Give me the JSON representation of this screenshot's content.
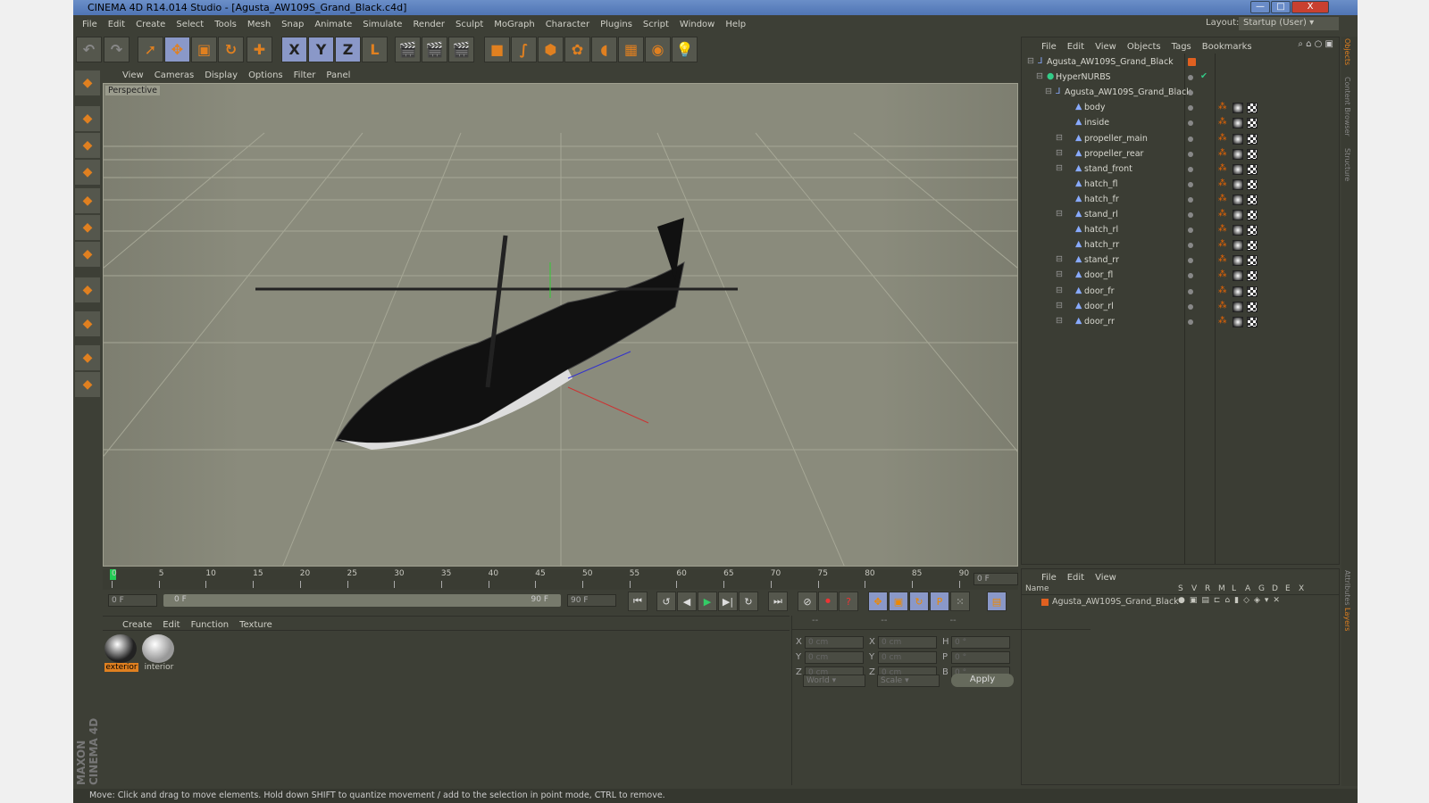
{
  "window": {
    "title": "CINEMA 4D R14.014 Studio - [Agusta_AW109S_Grand_Black.c4d]",
    "minimize": "—",
    "maximize": "□",
    "close": "X"
  },
  "menu": [
    "File",
    "Edit",
    "Create",
    "Select",
    "Tools",
    "Mesh",
    "Snap",
    "Animate",
    "Simulate",
    "Render",
    "Sculpt",
    "MoGraph",
    "Character",
    "Plugins",
    "Script",
    "Window",
    "Help"
  ],
  "layout": {
    "label": "Layout:",
    "value": "Startup (User)"
  },
  "toolbar": [
    {
      "icon": "undo-icon",
      "g": "↶"
    },
    {
      "icon": "redo-icon",
      "g": "↷"
    },
    {
      "icon": "select-arrow-icon",
      "g": "➚"
    },
    {
      "icon": "move-icon",
      "g": "✥",
      "sel": true
    },
    {
      "icon": "scale-icon",
      "g": "▣"
    },
    {
      "icon": "rotate-icon",
      "g": "↻"
    },
    {
      "icon": "live-select-icon",
      "g": "✚"
    },
    {
      "icon": "x-axis-icon",
      "g": "X",
      "sel": true
    },
    {
      "icon": "y-axis-icon",
      "g": "Y",
      "sel": true
    },
    {
      "icon": "z-axis-icon",
      "g": "Z",
      "sel": true
    },
    {
      "icon": "coordinate-system-icon",
      "g": "L"
    },
    {
      "icon": "render-view-icon",
      "g": "🎬"
    },
    {
      "icon": "render-picture-viewer-icon",
      "g": "🎬"
    },
    {
      "icon": "render-settings-icon",
      "g": "🎬"
    },
    {
      "icon": "cube-icon",
      "g": "■"
    },
    {
      "icon": "spline-icon",
      "g": "∫"
    },
    {
      "icon": "nurbs-icon",
      "g": "⬢"
    },
    {
      "icon": "array-icon",
      "g": "✿"
    },
    {
      "icon": "deformer-icon",
      "g": "◖"
    },
    {
      "icon": "floor-icon",
      "g": "▦"
    },
    {
      "icon": "camera-icon",
      "g": "◉"
    },
    {
      "icon": "light-icon",
      "g": "💡"
    }
  ],
  "left_tools": [
    "make-editable-icon",
    "model-mode-icon",
    "texture-mode-icon",
    "workplane-icon",
    "points-mode-icon",
    "edges-mode-icon",
    "polygons-mode-icon",
    "axis-mode-icon",
    "magnet-icon",
    "snap-icon",
    "locked-workplane-icon"
  ],
  "viewport": {
    "menu": [
      "View",
      "Cameras",
      "Display",
      "Options",
      "Filter",
      "Panel"
    ],
    "label": "Perspective"
  },
  "timeline": {
    "ticks": [
      "0",
      "5",
      "10",
      "15",
      "20",
      "25",
      "30",
      "35",
      "40",
      "45",
      "50",
      "55",
      "60",
      "65",
      "70",
      "75",
      "80",
      "85",
      "90"
    ],
    "current": "0 F",
    "start": "0 F",
    "range_start": "0 F",
    "range_end": "90 F",
    "end": "90 F"
  },
  "materials": {
    "menu": [
      "Create",
      "Edit",
      "Function",
      "Texture"
    ],
    "items": [
      {
        "name": "exterior",
        "selected": true
      },
      {
        "name": "interior",
        "selected": false
      }
    ]
  },
  "coords": {
    "headers": [
      "--",
      "--",
      "--"
    ],
    "rows": [
      [
        "X",
        "0 cm",
        "X",
        "0 cm",
        "H",
        "0 °"
      ],
      [
        "Y",
        "0 cm",
        "Y",
        "0 cm",
        "P",
        "0 °"
      ],
      [
        "Z",
        "0 cm",
        "Z",
        "0 cm",
        "B",
        "0 °"
      ]
    ],
    "world": "World",
    "scale": "Scale",
    "apply": "Apply"
  },
  "objects": {
    "menu": [
      "File",
      "Edit",
      "View",
      "Objects",
      "Tags",
      "Bookmarks"
    ],
    "tree": [
      {
        "name": "Agusta_AW109S_Grand_Black",
        "level": 0,
        "type": "null"
      },
      {
        "name": "HyperNURBS",
        "level": 1,
        "type": "nurbs"
      },
      {
        "name": "Agusta_AW109S_Grand_Black",
        "level": 2,
        "type": "null"
      },
      {
        "name": "body",
        "level": 3
      },
      {
        "name": "inside",
        "level": 3
      },
      {
        "name": "propeller_main",
        "level": 3,
        "exp": true
      },
      {
        "name": "propeller_rear",
        "level": 3,
        "exp": true
      },
      {
        "name": "stand_front",
        "level": 3,
        "exp": true
      },
      {
        "name": "hatch_fl",
        "level": 3
      },
      {
        "name": "hatch_fr",
        "level": 3
      },
      {
        "name": "stand_rl",
        "level": 3,
        "exp": true
      },
      {
        "name": "hatch_rl",
        "level": 3
      },
      {
        "name": "hatch_rr",
        "level": 3
      },
      {
        "name": "stand_rr",
        "level": 3,
        "exp": true
      },
      {
        "name": "door_fl",
        "level": 3,
        "exp": true
      },
      {
        "name": "door_fr",
        "level": 3,
        "exp": true
      },
      {
        "name": "door_rl",
        "level": 3,
        "exp": true
      },
      {
        "name": "door_rr",
        "level": 3,
        "exp": true
      }
    ]
  },
  "layers": {
    "menu": [
      "File",
      "Edit",
      "View"
    ],
    "columns": [
      "Name",
      "S",
      "V",
      "R",
      "M",
      "L",
      "A",
      "G",
      "D",
      "E",
      "X"
    ],
    "items": [
      {
        "name": "Agusta_AW109S_Grand_Black",
        "color": "#e06020"
      }
    ]
  },
  "right_tabs": [
    "Objects",
    "Content Browser",
    "Structure"
  ],
  "right_tabs_bottom": [
    "Attributes",
    "Layers"
  ],
  "status": "Move: Click and drag to move elements. Hold down SHIFT to quantize movement / add to the selection in point mode, CTRL to remove.",
  "brand": "MAXON CINEMA 4D",
  "colors": {
    "accent": "#e08020",
    "selection": "#8a98c8",
    "bg": "#3d3f36"
  }
}
